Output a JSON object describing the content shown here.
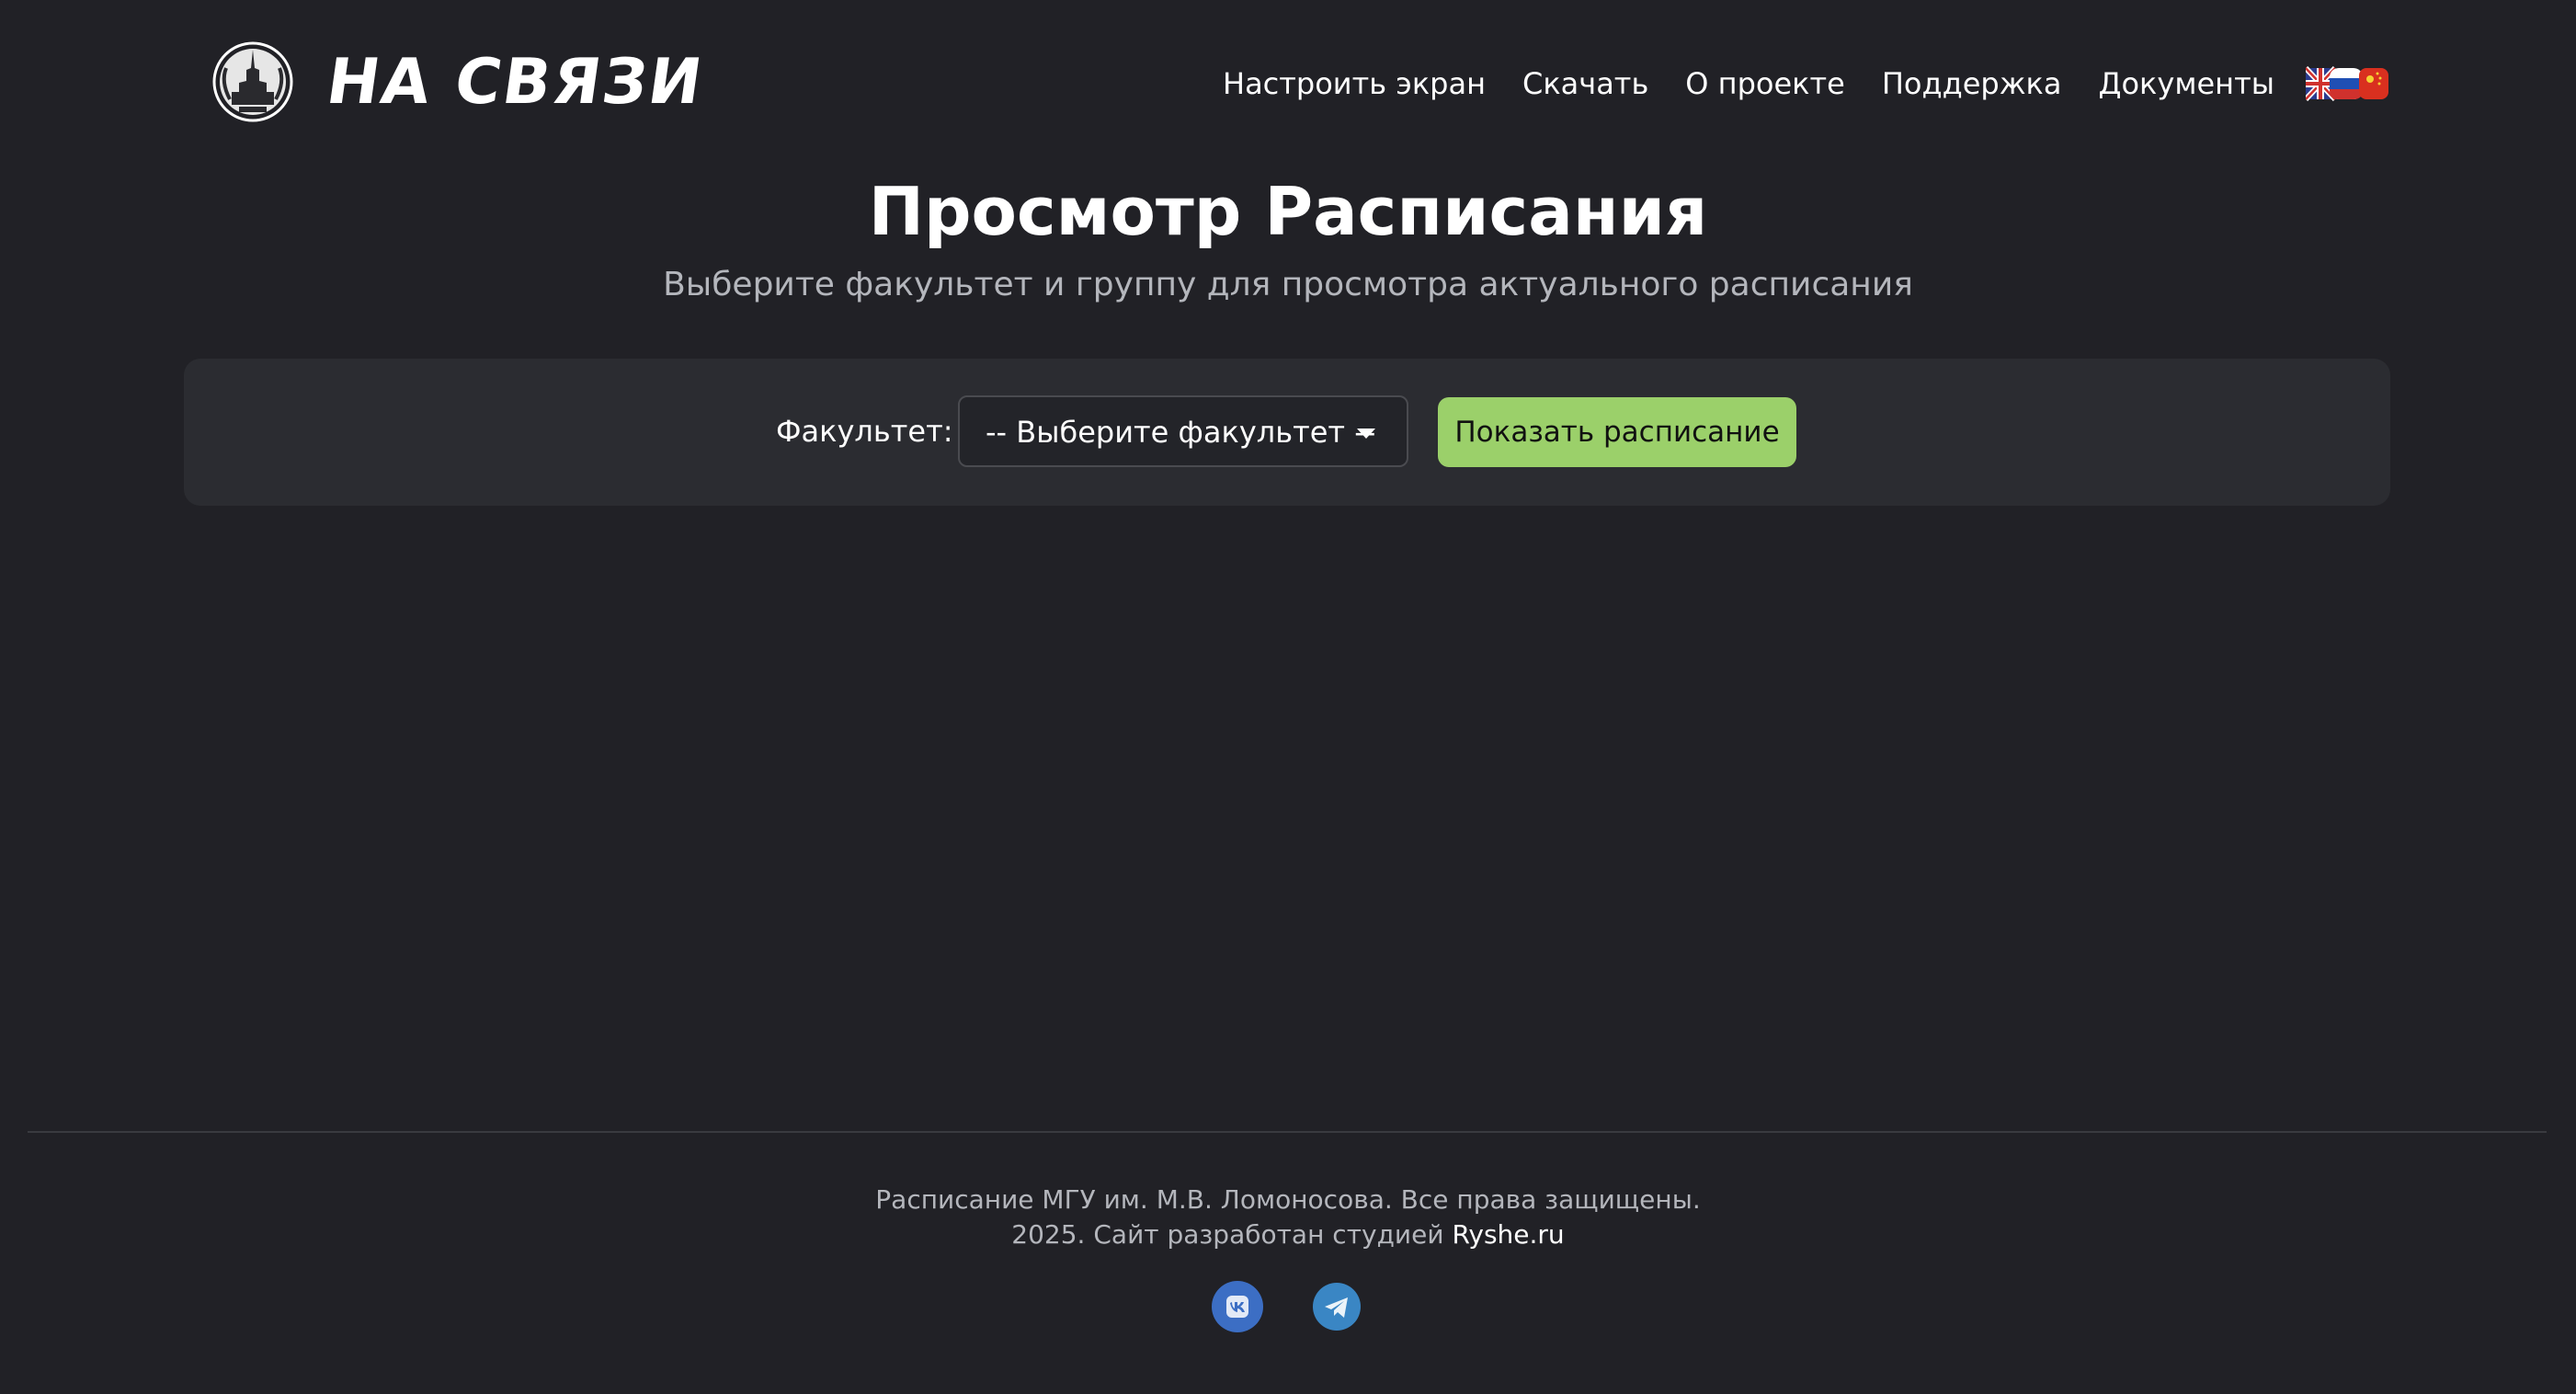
{
  "header": {
    "brand": "НА СВЯЗИ",
    "nav": [
      {
        "label": "Настроить экран"
      },
      {
        "label": "Скачать"
      },
      {
        "label": "О проекте"
      },
      {
        "label": "Поддержка"
      },
      {
        "label": "Документы"
      }
    ],
    "language_icons": [
      "uk-flag-icon",
      "russia-flag-icon",
      "china-flag-icon"
    ]
  },
  "hero": {
    "title": "Просмотр Расписания",
    "subtitle": "Выберите факультет и группу для просмотра актуального расписания"
  },
  "filters": {
    "faculty_label": "Факультет:",
    "faculty_select_value": "-- Выберите факультет --",
    "show_button_label": "Показать расписание"
  },
  "footer": {
    "line1": "Расписание МГУ им. М.В. Ломоносова. Все права защищены.",
    "line2_prefix": "2025. Сайт разработан студией ",
    "line2_link": "Ryshe.ru",
    "social_icons": [
      "vk-icon",
      "telegram-icon"
    ]
  },
  "colors": {
    "background": "#212126",
    "panel": "#2b2c31",
    "accent_button": "#9bd06a",
    "muted_text": "#b4b6bc",
    "vk": "#3c6ec4",
    "telegram": "#3a86c4"
  }
}
